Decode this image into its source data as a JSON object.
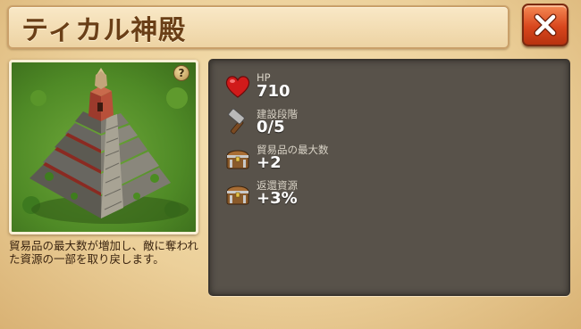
{
  "header": {
    "title": "ティカル神殿"
  },
  "close_button": {
    "icon": "close-x-icon",
    "color": "#d8461d"
  },
  "building": {
    "image": "pyramid-temple-image",
    "help_icon_glyph": "?",
    "description": "貿易品の最大数が増加し、敵に奪われた資源の一部を取り戻します。"
  },
  "stats": [
    {
      "icon": "heart-icon",
      "label": "HP",
      "value": "710"
    },
    {
      "icon": "hammer-icon",
      "label": "建設段階",
      "value": "0/5"
    },
    {
      "icon": "treasure-chest-icon",
      "label": "貿易品の最大数",
      "value": "+2"
    },
    {
      "icon": "treasure-chest-icon",
      "label": "返還資源",
      "value": "+3%"
    }
  ]
}
